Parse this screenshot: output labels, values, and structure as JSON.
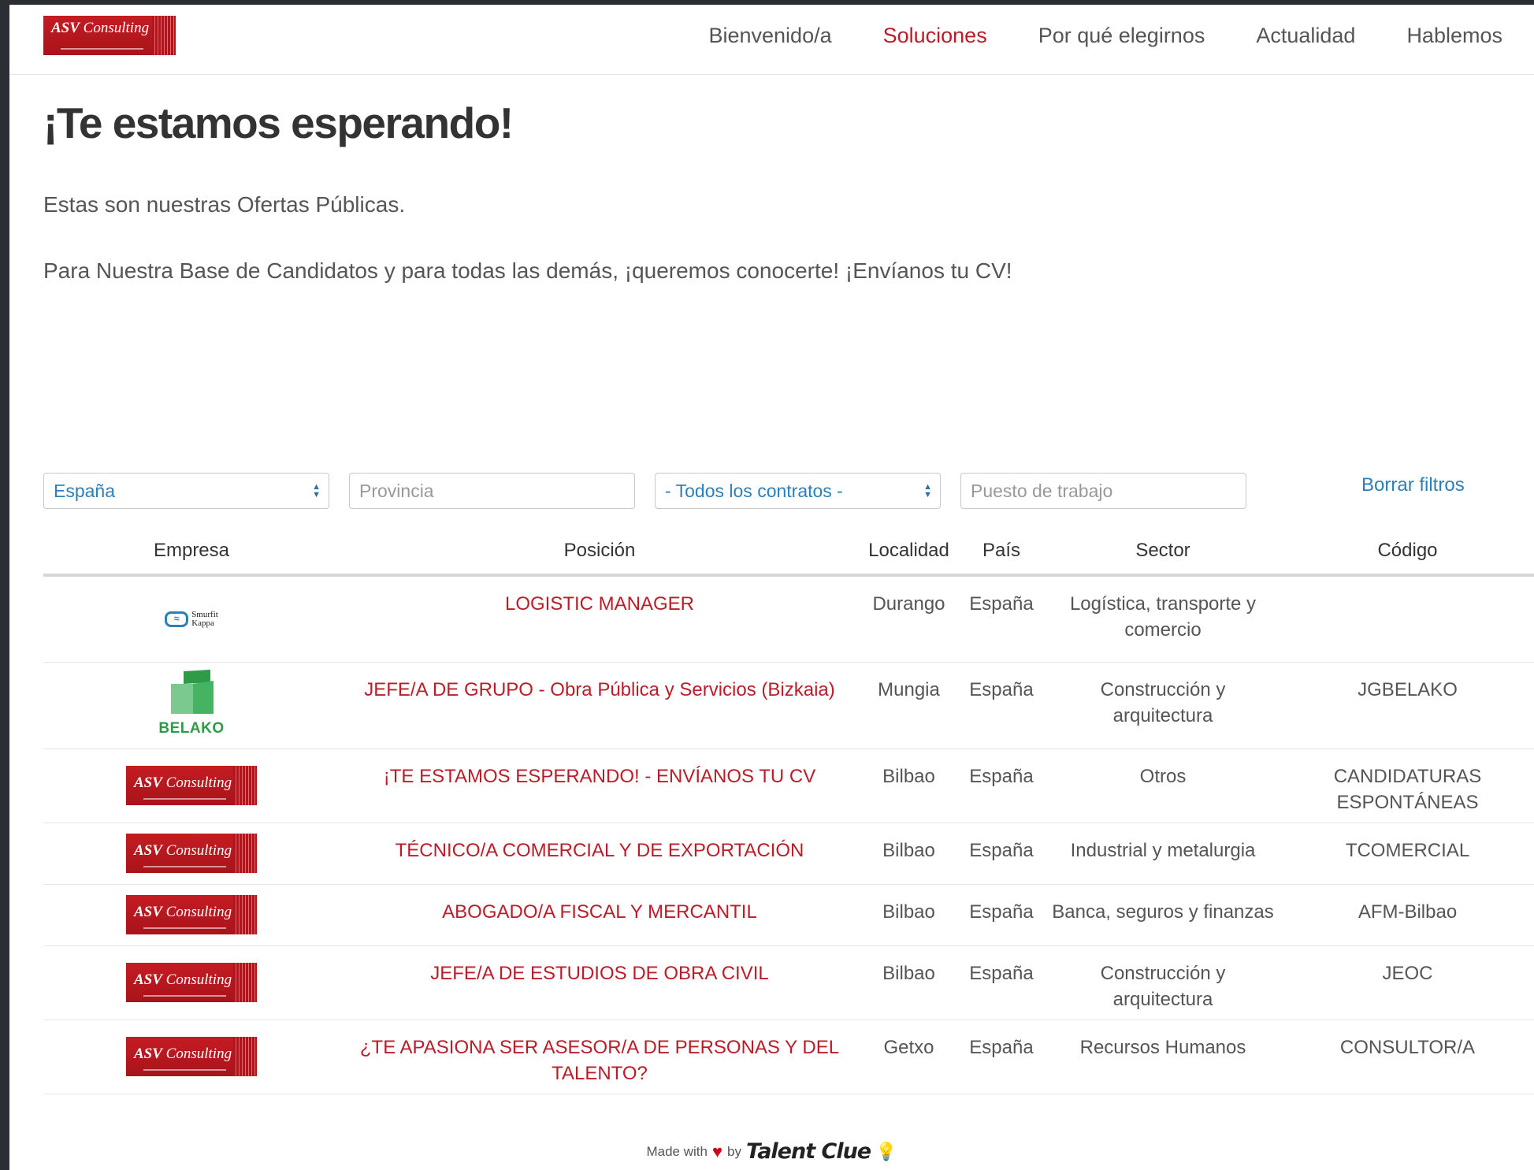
{
  "header": {
    "logo_text": "ASV Consulting",
    "nav": [
      {
        "label": "Bienvenido/a",
        "active": false
      },
      {
        "label": "Soluciones",
        "active": true
      },
      {
        "label": "Por qué elegirnos",
        "active": false
      },
      {
        "label": "Actualidad",
        "active": false
      },
      {
        "label": "Hablemos",
        "active": false
      }
    ]
  },
  "main": {
    "title": "¡Te estamos esperando!",
    "intro1": "Estas son nuestras Ofertas Públicas.",
    "intro2": "Para Nuestra Base de Candidatos y para todas las demás, ¡queremos conocerte! ¡Envíanos tu CV!"
  },
  "filters": {
    "country_value": "España",
    "province_placeholder": "Provincia",
    "contract_value": "- Todos los contratos -",
    "job_placeholder": "Puesto de trabajo",
    "clear_label": "Borrar filtros"
  },
  "table": {
    "headers": [
      "Empresa",
      "Posición",
      "Localidad",
      "País",
      "Sector",
      "Código"
    ],
    "rows": [
      {
        "company": "Smurfit Kappa",
        "position": "LOGISTIC MANAGER",
        "locality": "Durango",
        "country": "España",
        "sector": "Logística, transporte y comercio",
        "code": ""
      },
      {
        "company": "BELAKO",
        "position": "JEFE/A DE GRUPO - Obra Pública y Servicios (Bizkaia)",
        "locality": "Mungia",
        "country": "España",
        "sector": "Construcción y arquitectura",
        "code": "JGBELAKO"
      },
      {
        "company": "ASV Consulting",
        "position": "¡TE ESTAMOS ESPERANDO! - ENVÍANOS TU CV",
        "locality": "Bilbao",
        "country": "España",
        "sector": "Otros",
        "code": "CANDIDATURAS ESPONTÁNEAS"
      },
      {
        "company": "ASV Consulting",
        "position": "TÉCNICO/A COMERCIAL Y DE EXPORTACIÓN",
        "locality": "Bilbao",
        "country": "España",
        "sector": "Industrial y metalurgia",
        "code": "TCOMERCIAL"
      },
      {
        "company": "ASV Consulting",
        "position": "ABOGADO/A FISCAL Y MERCANTIL",
        "locality": "Bilbao",
        "country": "España",
        "sector": "Banca, seguros y finanzas",
        "code": "AFM-Bilbao"
      },
      {
        "company": "ASV Consulting",
        "position": "JEFE/A DE ESTUDIOS DE OBRA CIVIL",
        "locality": "Bilbao",
        "country": "España",
        "sector": "Construcción y arquitectura",
        "code": "JEOC"
      },
      {
        "company": "ASV Consulting",
        "position": "¿TE APASIONA SER ASESOR/A DE PERSONAS Y DEL TALENTO?",
        "locality": "Getxo",
        "country": "España",
        "sector": "Recursos Humanos",
        "code": "CONSULTOR/A"
      }
    ]
  },
  "footer": {
    "made_with": "Made with",
    "by": "by",
    "brand": "Talent Clue"
  },
  "colors": {
    "brand_red": "#b81e2a",
    "link_blue": "#2d7fb8"
  }
}
